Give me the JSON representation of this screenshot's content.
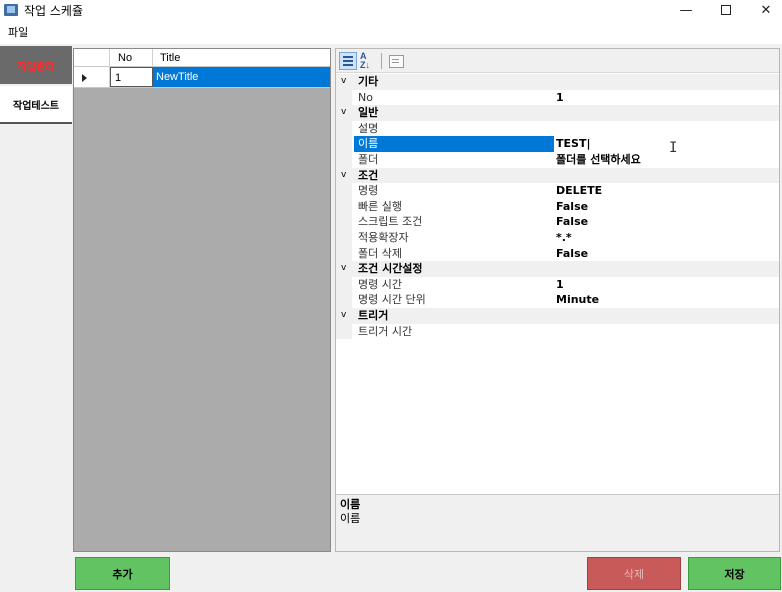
{
  "window": {
    "title": "작업 스케쥴",
    "minimize": "—",
    "close": "✕"
  },
  "menu": {
    "file": "파일"
  },
  "tabs": [
    {
      "label": "작업관리",
      "active": true
    },
    {
      "label": "작업테스트",
      "active": false
    }
  ],
  "grid": {
    "columns": [
      "No",
      "Title"
    ],
    "rows": [
      {
        "no": "1",
        "title": "NewTitle",
        "selected": true
      }
    ]
  },
  "property_grid": {
    "toolbar": {
      "categorized_icon": "categorized-icon",
      "alphabetical_icon": "alphabetical-sort-icon",
      "alpha_top": "A",
      "alpha_bottom": "Z↓",
      "pages_icon": "property-pages-icon"
    },
    "categories": [
      {
        "name": "기타",
        "properties": [
          {
            "name": "No",
            "value": "1"
          }
        ]
      },
      {
        "name": "일반",
        "properties": [
          {
            "name": "설명",
            "value": ""
          },
          {
            "name": "이름",
            "value": "TEST|",
            "selected": true
          },
          {
            "name": "폴더",
            "value": "폴더를 선택하세요"
          }
        ]
      },
      {
        "name": "조건",
        "properties": [
          {
            "name": "명령",
            "value": "DELETE"
          },
          {
            "name": "빠른 실행",
            "value": "False"
          },
          {
            "name": "스크립트 조건",
            "value": "False"
          },
          {
            "name": "적용확장자",
            "value": "*.*"
          },
          {
            "name": "폴더 삭제",
            "value": "False"
          }
        ]
      },
      {
        "name": "조건 시간설정",
        "properties": [
          {
            "name": "명령 시간",
            "value": "1"
          },
          {
            "name": "명령 시간 단위",
            "value": "Minute"
          }
        ]
      },
      {
        "name": "트리거",
        "properties": [
          {
            "name": "트리거 시간",
            "value": ""
          }
        ]
      }
    ],
    "expand_glyph": "v",
    "description": {
      "title": "이름",
      "text": "이름"
    }
  },
  "buttons": {
    "add": "추가",
    "delete": "삭제",
    "save": "저장"
  },
  "colors": {
    "selection": "#0078d7",
    "button_green": "#62c362",
    "button_red": "#c85a5a",
    "active_tab_text": "#ff2a2a"
  }
}
